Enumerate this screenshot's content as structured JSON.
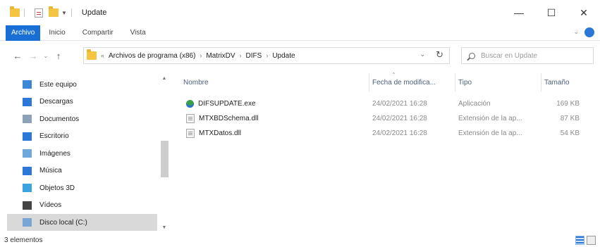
{
  "window": {
    "title": "Update",
    "minimize": "—",
    "maximize": "☐",
    "close": "✕"
  },
  "ribbon": {
    "tabs": [
      "Archivo",
      "Inicio",
      "Compartir",
      "Vista"
    ],
    "active": "Archivo",
    "expand": "⌄"
  },
  "address": {
    "back": "←",
    "forward": "→",
    "recent": "⌄",
    "up": "↑",
    "overflow": "«",
    "crumbs": [
      "Archivos de programa (x86)",
      "MatrixDV",
      "DIFS",
      "Update"
    ],
    "separator": "›",
    "dropdown": "⌄",
    "refresh": "↻"
  },
  "search": {
    "placeholder": "Buscar en Update"
  },
  "nav": {
    "items": [
      {
        "label": "Este equipo",
        "icon": "computer-icon",
        "color": "#3b86d6"
      },
      {
        "label": "Descargas",
        "icon": "download-icon",
        "color": "#2b78d8"
      },
      {
        "label": "Documentos",
        "icon": "documents-icon",
        "color": "#8da2b8"
      },
      {
        "label": "Escritorio",
        "icon": "desktop-icon",
        "color": "#2b78d8"
      },
      {
        "label": "Imágenes",
        "icon": "pictures-icon",
        "color": "#6fa8dc"
      },
      {
        "label": "Música",
        "icon": "music-icon",
        "color": "#2b78d8"
      },
      {
        "label": "Objetos 3D",
        "icon": "objects-3d-icon",
        "color": "#3aa3e0"
      },
      {
        "label": "Vídeos",
        "icon": "videos-icon",
        "color": "#444444"
      },
      {
        "label": "Disco local (C:)",
        "icon": "disk-icon",
        "color": "#7aa6d6"
      }
    ],
    "selected_index": 8
  },
  "columns": [
    "Nombre",
    "Fecha de modifica...",
    "Tipo",
    "Tamaño"
  ],
  "files": [
    {
      "name": "DIFSUPDATE.exe",
      "date": "24/02/2021 16:28",
      "type": "Aplicación",
      "size": "169 KB",
      "icon": "exe"
    },
    {
      "name": "MTXBDSchema.dll",
      "date": "24/02/2021 16:28",
      "type": "Extensión de la ap...",
      "size": "87 KB",
      "icon": "dll"
    },
    {
      "name": "MTXDatos.dll",
      "date": "24/02/2021 16:28",
      "type": "Extensión de la ap...",
      "size": "54 KB",
      "icon": "dll"
    }
  ],
  "status": {
    "count": "3 elementos"
  }
}
